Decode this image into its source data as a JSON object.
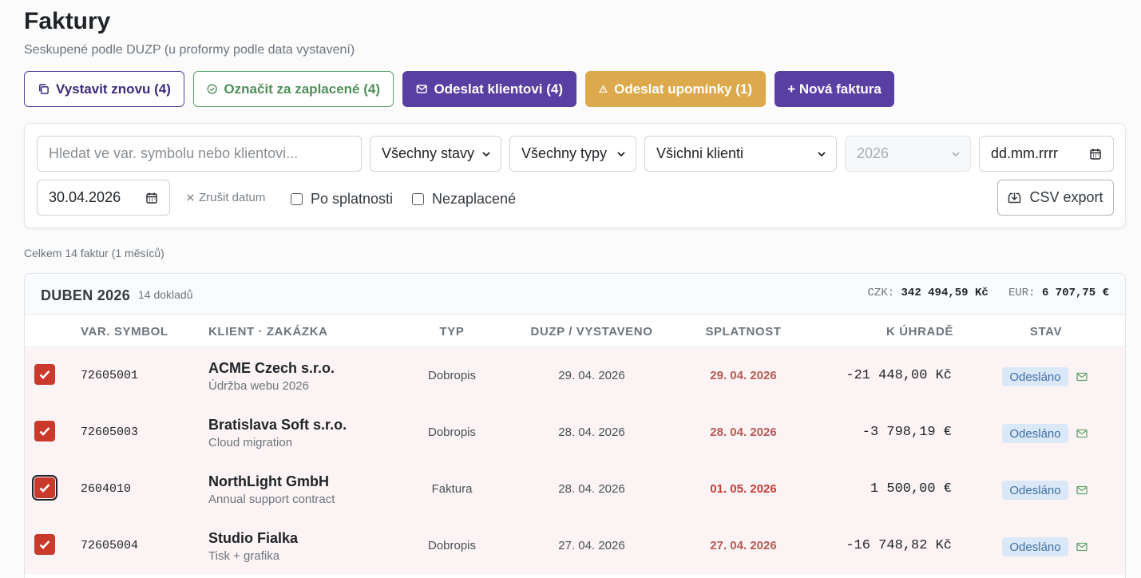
{
  "page": {
    "title": "Faktury",
    "subtitle": "Seskupené podle DUZP (u proformy podle data vystavení)"
  },
  "actions": {
    "reissue": "Vystavit znovu (4)",
    "mark_paid": "Označit za zaplacené (4)",
    "send_client": "Odeslat klientovi (4)",
    "send_reminders": "Odeslat upomínky (1)",
    "new_invoice": "+ Nová faktura"
  },
  "filters": {
    "search_placeholder": "Hledat ve var. symbolu nebo klientovi...",
    "status": "Všechny stavy",
    "type": "Všechny typy",
    "client": "Všichni klienti",
    "year": "2026",
    "date_from": "dd.mm.rrrr",
    "date_to": "30.04.2026",
    "clear_date": "Zrušit datum",
    "overdue": "Po splatnosti",
    "unpaid": "Nezaplacené",
    "csv": "CSV export"
  },
  "summary": "Celkem 14 faktur (1 měsíců)",
  "group": {
    "title": "DUBEN 2026",
    "count": "14 dokladů",
    "czk_label": "CZK:",
    "czk_total": "342 494,59 Kč",
    "eur_label": "EUR:",
    "eur_total": "6 707,75 €"
  },
  "columns": [
    "VAR. SYMBOL",
    "KLIENT · ZAKÁZKA",
    "TYP",
    "DUZP / VYSTAVENO",
    "SPLATNOST",
    "K ÚHRADĚ",
    "STAV"
  ],
  "rows": [
    {
      "vs": "72605001",
      "client": "ACME Czech s.r.o.",
      "project": "Údržba webu 2026",
      "type": "Dobropis",
      "duzp": "29. 04. 2026",
      "due": "29. 04. 2026",
      "amount": "-21 448,00 Kč",
      "status": "Odesláno",
      "checked": true
    },
    {
      "vs": "72605003",
      "client": "Bratislava Soft s.r.o.",
      "project": "Cloud migration",
      "type": "Dobropis",
      "duzp": "28. 04. 2026",
      "due": "28. 04. 2026",
      "amount": "-3 798,19 €",
      "status": "Odesláno",
      "checked": true
    },
    {
      "vs": "2604010",
      "client": "NorthLight GmbH",
      "project": "Annual support contract",
      "type": "Faktura",
      "duzp": "28. 04. 2026",
      "due": "01. 05. 2026",
      "amount": "1 500,00 €",
      "status": "Odesláno",
      "checked": true
    },
    {
      "vs": "72605004",
      "client": "Studio Fialka",
      "project": "Tisk + grafika",
      "type": "Dobropis",
      "duzp": "27. 04. 2026",
      "due": "27. 04. 2026",
      "amount": "-16 748,82 Kč",
      "status": "Odesláno",
      "checked": true
    }
  ],
  "colors": {
    "accent": "#5a3fa3",
    "success": "#5fa36b",
    "warning": "#dcaa4c",
    "danger": "#c9392c"
  }
}
